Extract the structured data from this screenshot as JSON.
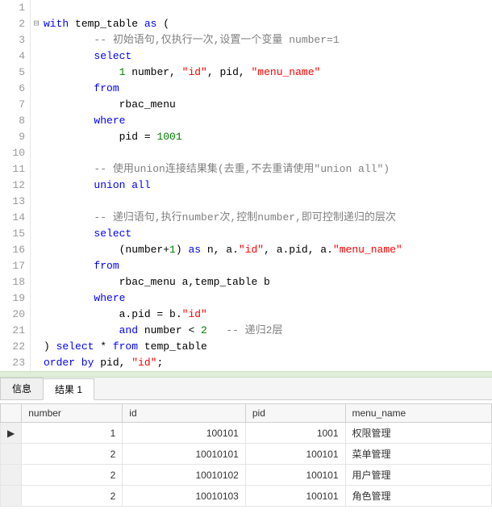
{
  "editor": {
    "lines": [
      {
        "n": "1",
        "fold": "",
        "tokens": []
      },
      {
        "n": "2",
        "fold": "⊟",
        "tokens": [
          {
            "t": "with",
            "c": "kw"
          },
          {
            "t": " temp_table ",
            "c": "ident"
          },
          {
            "t": "as",
            "c": "kw"
          },
          {
            "t": " (",
            "c": "ident"
          }
        ]
      },
      {
        "n": "3",
        "fold": "",
        "tokens": [
          {
            "t": "        ",
            "c": "ident"
          },
          {
            "t": "-- 初始语句,仅执行一次,设置一个变量 number=1",
            "c": "com"
          }
        ]
      },
      {
        "n": "4",
        "fold": "",
        "tokens": [
          {
            "t": "        ",
            "c": "ident"
          },
          {
            "t": "select",
            "c": "kw"
          }
        ]
      },
      {
        "n": "5",
        "fold": "",
        "tokens": [
          {
            "t": "            ",
            "c": "ident"
          },
          {
            "t": "1",
            "c": "num"
          },
          {
            "t": " number, ",
            "c": "ident"
          },
          {
            "t": "\"id\"",
            "c": "str"
          },
          {
            "t": ", pid, ",
            "c": "ident"
          },
          {
            "t": "\"menu_name\"",
            "c": "str"
          }
        ]
      },
      {
        "n": "6",
        "fold": "",
        "tokens": [
          {
            "t": "        ",
            "c": "ident"
          },
          {
            "t": "from",
            "c": "kw"
          }
        ]
      },
      {
        "n": "7",
        "fold": "",
        "tokens": [
          {
            "t": "            rbac_menu",
            "c": "ident"
          }
        ]
      },
      {
        "n": "8",
        "fold": "",
        "tokens": [
          {
            "t": "        ",
            "c": "ident"
          },
          {
            "t": "where",
            "c": "kw"
          }
        ]
      },
      {
        "n": "9",
        "fold": "",
        "tokens": [
          {
            "t": "            pid = ",
            "c": "ident"
          },
          {
            "t": "1001",
            "c": "num"
          }
        ]
      },
      {
        "n": "10",
        "fold": "",
        "tokens": []
      },
      {
        "n": "11",
        "fold": "",
        "tokens": [
          {
            "t": "        ",
            "c": "ident"
          },
          {
            "t": "-- 使用union连接结果集(去重,不去重请使用\"union all\")",
            "c": "com"
          }
        ]
      },
      {
        "n": "12",
        "fold": "",
        "tokens": [
          {
            "t": "        ",
            "c": "ident"
          },
          {
            "t": "union all",
            "c": "kw"
          }
        ]
      },
      {
        "n": "13",
        "fold": "",
        "tokens": []
      },
      {
        "n": "14",
        "fold": "",
        "tokens": [
          {
            "t": "        ",
            "c": "ident"
          },
          {
            "t": "-- 递归语句,执行number次,控制number,即可控制递归的层次",
            "c": "com"
          }
        ]
      },
      {
        "n": "15",
        "fold": "",
        "tokens": [
          {
            "t": "        ",
            "c": "ident"
          },
          {
            "t": "select",
            "c": "kw"
          }
        ]
      },
      {
        "n": "16",
        "fold": "",
        "tokens": [
          {
            "t": "            (number+",
            "c": "ident"
          },
          {
            "t": "1",
            "c": "num"
          },
          {
            "t": ") ",
            "c": "ident"
          },
          {
            "t": "as",
            "c": "kw"
          },
          {
            "t": " n, a.",
            "c": "ident"
          },
          {
            "t": "\"id\"",
            "c": "str"
          },
          {
            "t": ", a.pid, a.",
            "c": "ident"
          },
          {
            "t": "\"menu_name\"",
            "c": "str"
          }
        ]
      },
      {
        "n": "17",
        "fold": "",
        "tokens": [
          {
            "t": "        ",
            "c": "ident"
          },
          {
            "t": "from",
            "c": "kw"
          }
        ]
      },
      {
        "n": "18",
        "fold": "",
        "tokens": [
          {
            "t": "            rbac_menu a,temp_table b",
            "c": "ident"
          }
        ]
      },
      {
        "n": "19",
        "fold": "",
        "tokens": [
          {
            "t": "        ",
            "c": "ident"
          },
          {
            "t": "where",
            "c": "kw"
          }
        ]
      },
      {
        "n": "20",
        "fold": "",
        "tokens": [
          {
            "t": "            a.pid = b.",
            "c": "ident"
          },
          {
            "t": "\"id\"",
            "c": "str"
          }
        ]
      },
      {
        "n": "21",
        "fold": "",
        "tokens": [
          {
            "t": "            ",
            "c": "ident"
          },
          {
            "t": "and",
            "c": "kw"
          },
          {
            "t": " number < ",
            "c": "ident"
          },
          {
            "t": "2",
            "c": "num"
          },
          {
            "t": "   ",
            "c": "ident"
          },
          {
            "t": "-- 递归2层",
            "c": "com"
          }
        ]
      },
      {
        "n": "22",
        "fold": "",
        "tokens": [
          {
            "t": ") ",
            "c": "ident"
          },
          {
            "t": "select",
            "c": "kw"
          },
          {
            "t": " * ",
            "c": "ident"
          },
          {
            "t": "from",
            "c": "kw"
          },
          {
            "t": " temp_table",
            "c": "ident"
          }
        ]
      },
      {
        "n": "23",
        "fold": "",
        "tokens": [
          {
            "t": "order by",
            "c": "kw"
          },
          {
            "t": " pid, ",
            "c": "ident"
          },
          {
            "t": "\"id\"",
            "c": "str"
          },
          {
            "t": ";",
            "c": "ident"
          }
        ]
      }
    ]
  },
  "tabs": {
    "info": "信息",
    "result": "结果 1"
  },
  "results": {
    "columns": [
      "number",
      "id",
      "pid",
      "menu_name"
    ],
    "rows": [
      {
        "_marker": "▶",
        "number": "1",
        "id": "100101",
        "pid": "1001",
        "menu_name": "权限管理"
      },
      {
        "_marker": "",
        "number": "2",
        "id": "10010101",
        "pid": "100101",
        "menu_name": "菜单管理"
      },
      {
        "_marker": "",
        "number": "2",
        "id": "10010102",
        "pid": "100101",
        "menu_name": "用户管理"
      },
      {
        "_marker": "",
        "number": "2",
        "id": "10010103",
        "pid": "100101",
        "menu_name": "角色管理"
      }
    ]
  }
}
